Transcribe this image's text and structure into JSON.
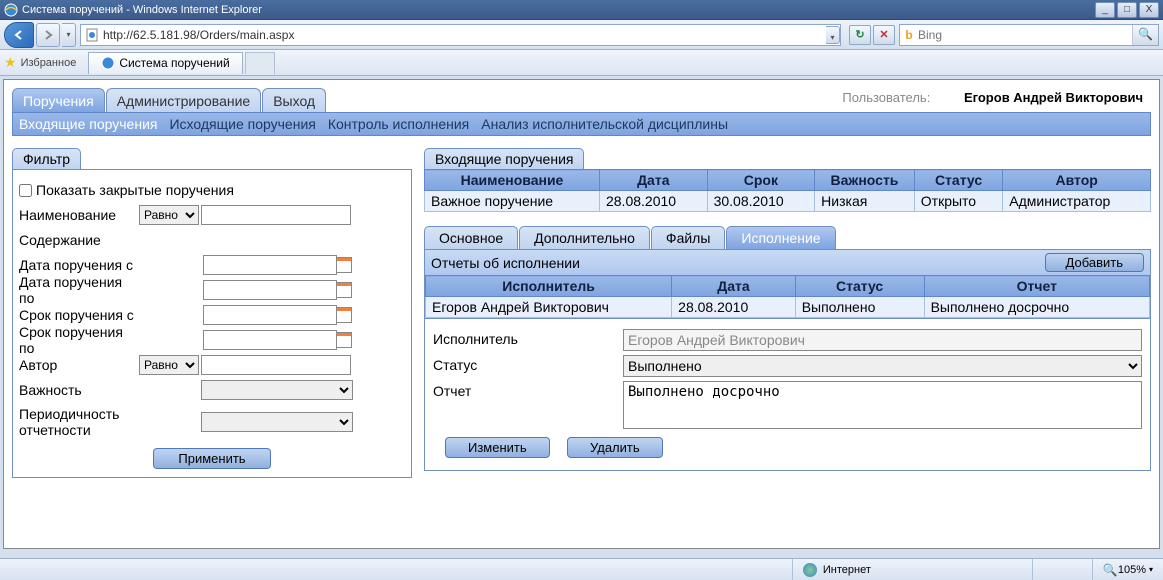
{
  "window": {
    "title": "Система поручений - Windows Internet Explorer",
    "min": "_",
    "max": "□",
    "close": "X"
  },
  "nav": {
    "url": "http://62.5.181.98/Orders/main.aspx",
    "refresh": "↻",
    "stop": "✕",
    "search_engine": "Bing",
    "search_glyph": "🔍"
  },
  "favorites": {
    "label": "Избранное",
    "tab": "Система поручений"
  },
  "user": {
    "label": "Пользователь:",
    "name": "Егоров Андрей Викторович"
  },
  "main_tabs": [
    "Поручения",
    "Администрирование",
    "Выход"
  ],
  "sub_tabs": [
    "Входящие поручения",
    "Исходящие поручения",
    "Контроль исполнения",
    "Анализ исполнительской дисциплины"
  ],
  "filter": {
    "title": "Фильтр",
    "show_closed": "Показать закрытые поручения",
    "labels": {
      "name": "Наименование",
      "content": "Содержание",
      "date_from": "Дата поручения с",
      "date_to": "Дата поручения по",
      "due_from": "Срок поручения с",
      "due_to": "Срок поручения по",
      "author": "Автор",
      "importance": "Важность",
      "periodicity": "Периодичность отчетности"
    },
    "op_equal": "Равно",
    "apply": "Применить"
  },
  "grid": {
    "title": "Входящие поручения",
    "headers": [
      "Наименование",
      "Дата",
      "Срок",
      "Важность",
      "Статус",
      "Автор"
    ],
    "row": [
      "Важное поручение",
      "28.08.2010",
      "30.08.2010",
      "Низкая",
      "Открыто",
      "Администратор"
    ]
  },
  "detail_tabs": [
    "Основное",
    "Дополнительно",
    "Файлы",
    "Исполнение"
  ],
  "reports": {
    "title": "Отчеты об исполнении",
    "add": "Добавить",
    "headers": [
      "Исполнитель",
      "Дата",
      "Статус",
      "Отчет"
    ],
    "row": [
      "Егоров Андрей Викторович",
      "28.08.2010",
      "Выполнено",
      "Выполнено досрочно"
    ]
  },
  "form": {
    "executor_lbl": "Исполнитель",
    "executor_val": "Егоров Андрей Викторович",
    "status_lbl": "Статус",
    "status_val": "Выполнено",
    "report_lbl": "Отчет",
    "report_val": "Выполнено досрочно",
    "edit": "Изменить",
    "delete": "Удалить"
  },
  "status": {
    "zone": "Интернет",
    "zoom": "105%"
  }
}
